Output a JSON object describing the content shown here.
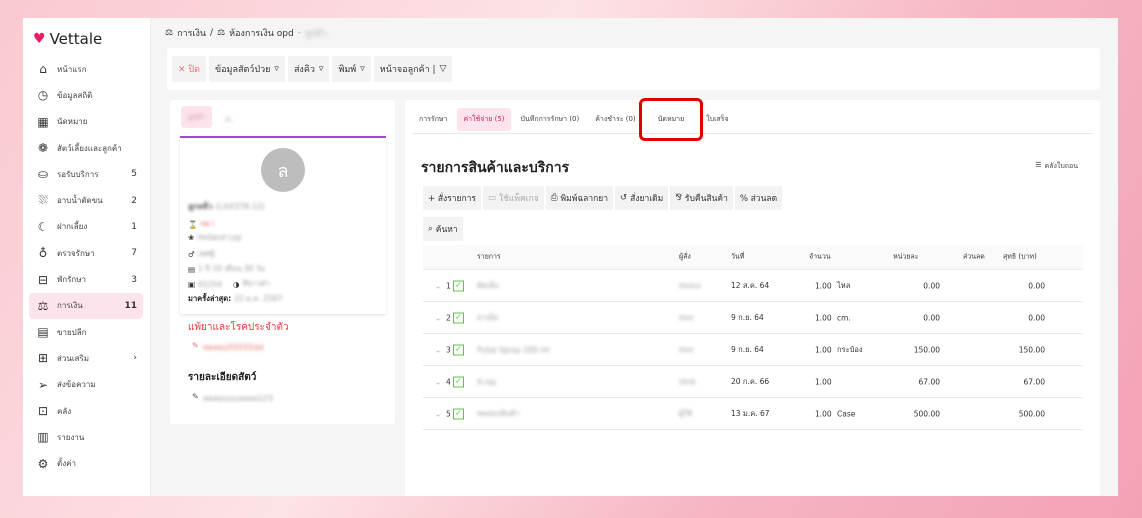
{
  "brand": "Vettale",
  "sidebar": {
    "items": [
      {
        "label": "หน้าแรก",
        "icon": "home-icon",
        "count": ""
      },
      {
        "label": "ข้อมูลสถิติ",
        "icon": "dashboard-icon",
        "count": ""
      },
      {
        "label": "นัดหมาย",
        "icon": "calendar-icon",
        "count": ""
      },
      {
        "label": "สัตว์เลี้ยงและลูกค้า",
        "icon": "paw-icon",
        "count": ""
      },
      {
        "label": "รอรับบริการ",
        "icon": "sofa-icon",
        "count": "5"
      },
      {
        "label": "อาบน้ำตัดขน",
        "icon": "bath-icon",
        "count": "2"
      },
      {
        "label": "ฝากเลี้ยง",
        "icon": "moon-icon",
        "count": "1"
      },
      {
        "label": "ตรวจรักษา",
        "icon": "stethoscope-icon",
        "count": "7"
      },
      {
        "label": "พักรักษา",
        "icon": "bed-icon",
        "count": "3"
      },
      {
        "label": "การเงิน",
        "icon": "finance-icon",
        "count": "11"
      },
      {
        "label": "ขายปลีก",
        "icon": "cash-register-icon",
        "count": ""
      },
      {
        "label": "ส่วนเสริม",
        "icon": "plus-box-icon",
        "count": "›"
      },
      {
        "label": "ส่งข้อความ",
        "icon": "send-icon",
        "count": ""
      },
      {
        "label": "คลัง",
        "icon": "archive-icon",
        "count": ""
      },
      {
        "label": "รายงาน",
        "icon": "chart-icon",
        "count": ""
      },
      {
        "label": "ตั้งค่า",
        "icon": "gear-icon",
        "count": ""
      }
    ]
  },
  "breadcrumb": {
    "item1": "การเงิน",
    "sep": "/",
    "item2": "ห้องการเงิน opd",
    "sep2": "-",
    "item3": "ลูกค้า"
  },
  "toolbar": {
    "close": "✕ ปิด",
    "pet_info": "ข้อมูลสัตว์ป่วย",
    "queue": "ส่งคิว",
    "print": "พิมพ์",
    "customer_screen": "หน้าจอลูกค้า |"
  },
  "pet": {
    "tab_active": "ลูกค้า",
    "tab2": "ค.",
    "avatar_letter": "ล",
    "name": "ลูกหลิ่ว",
    "code": "(LX4378-12)",
    "species": "หมา",
    "breed": "Holland Lop",
    "sex": "เพศผู้",
    "age": "1 ปี 10 เดือน 30 วัน",
    "chip": "01254",
    "color": "สีขาวดำ",
    "last_visit_label": "มาครั้งล่าสุด:",
    "last_visit": "22 ม.ค. 2567",
    "allergy_title": "แพ้ยาและโรคประจำตัว",
    "allergy_value": "ทดสอบ55555dd",
    "detail_title": "รายละเอียดสัตว์",
    "detail_value": "ทดสอบบบลลลล123"
  },
  "tabs": [
    "การรักษา",
    "ค่าใช้จ่าย (5)",
    "บันทึกการรักษา (0)",
    "ค้างชำระ (0)",
    "นัดหมาย",
    "ใบเสร็จ"
  ],
  "main": {
    "title": "รายการสินค้าและบริการ",
    "stock_history": "คลังใบถอน",
    "actions": [
      "+ สั่งรายการ",
      "ใช้แพ็คเกจ",
      "พิมพ์ฉลากยา",
      "สั่งยาเดิม",
      "รับคืนสินค้า",
      "% ส่วนลด"
    ],
    "search": "ค้นหา"
  },
  "table": {
    "headers": [
      "รายการ",
      "ผู้สั่ง",
      "วันที่",
      "จำนวน",
      "หน่วยละ",
      "ส่วนลด",
      "สุทธิ (บาท)"
    ],
    "rows": [
      {
        "no": "1",
        "item": "ตัดเล็บ",
        "by": "หมอเอ",
        "date": "12 ส.ค. 64",
        "qty": "1.00",
        "unit": "ไหล",
        "price": "0.00",
        "discount": "",
        "net": "0.00"
      },
      {
        "no": "2",
        "item": "ยาเม็ด",
        "by": "หมอ",
        "date": "9 ก.ย. 64",
        "qty": "1.00",
        "unit": "cm.",
        "price": "0.00",
        "discount": "",
        "net": "0.00"
      },
      {
        "no": "3",
        "item": "Pulse Spray 200 ml",
        "by": "หมอ",
        "date": "9 ก.ย. 64",
        "qty": "1.00",
        "unit": "กระป๋อง",
        "price": "150.00",
        "discount": "",
        "net": "150.00"
      },
      {
        "no": "4",
        "item": "X-ray",
        "by": "Uink",
        "date": "20 ก.ค. 66",
        "qty": "1.00",
        "unit": "",
        "price": "67.00",
        "discount": "",
        "net": "67.00"
      },
      {
        "no": "5",
        "item": "ทดสอบสินค้า",
        "by": "ผู้ใช้",
        "date": "13 ม.ค. 67",
        "qty": "1.00",
        "unit": "Case",
        "price": "500.00",
        "discount": "",
        "net": "500.00"
      }
    ]
  },
  "colors": {
    "accent": "#e91e63",
    "active_bg": "#fde4ec",
    "highlight": "#e00000",
    "check": "#5cc73b"
  }
}
